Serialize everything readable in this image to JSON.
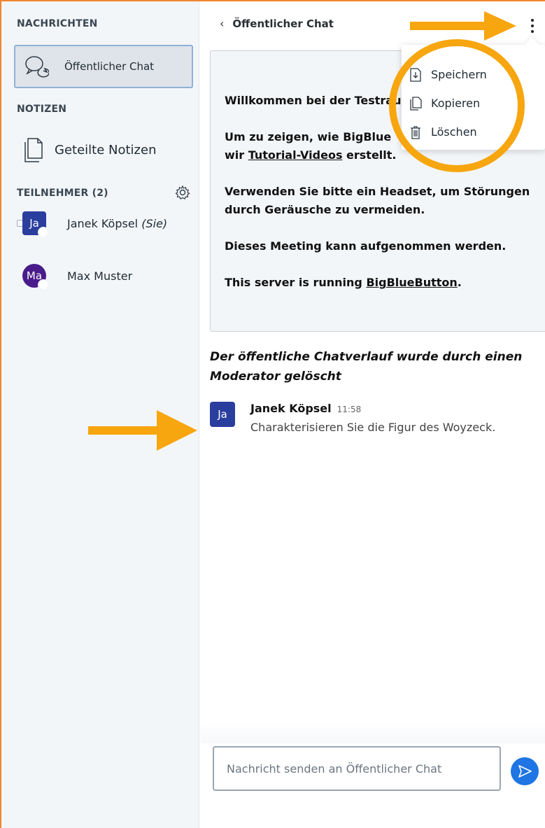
{
  "sidebar": {
    "messages_heading": "NACHRICHTEN",
    "public_chat_label": "Öffentlicher Chat",
    "notes_heading": "NOTIZEN",
    "shared_notes_label": "Geteilte Notizen",
    "participants_heading": "TEILNEHMER (2)",
    "participants": [
      {
        "initials": "Ja",
        "name": "Janek Köpsel",
        "suffix": "(Sie)",
        "color": "#2a3e9e",
        "shape": "square"
      },
      {
        "initials": "Ma",
        "name": "Max Muster",
        "suffix": "",
        "color": "#4a1b8a",
        "shape": "round"
      }
    ]
  },
  "chat": {
    "header_title": "Öffentlicher Chat",
    "welcome": {
      "line1_a": "Willkommen bei der Testr",
      "line1_b": "au",
      "line2_a": "Um zu zeigen, wie BigBlue",
      "line2_b_prefix": "wir ",
      "line2_link": "Tutorial-Videos",
      "line2_suffix": " erstellt.",
      "line3": "Verwenden Sie bitte ein Headset, um Störungen durch Geräusche zu vermeiden.",
      "line4": "Dieses Meeting kann aufgenommen werden.",
      "line5_prefix": "This server is running ",
      "line5_link": "BigBlueButton",
      "line5_suffix": "."
    },
    "cleared_notice": "Der öffentliche Chatverlauf wurde durch einen Moderator gelöscht",
    "message": {
      "initials": "Ja",
      "author": "Janek Köpsel",
      "time": "11:58",
      "text": "Charakterisieren Sie die Figur des Woyzeck."
    },
    "input_placeholder": "Nachricht senden an Öffentlicher Chat"
  },
  "menu": {
    "save": "Speichern",
    "copy": "Kopieren",
    "delete": "Löschen"
  },
  "colors": {
    "accent_orange": "#f7a60f",
    "send_blue": "#1f75e3"
  }
}
